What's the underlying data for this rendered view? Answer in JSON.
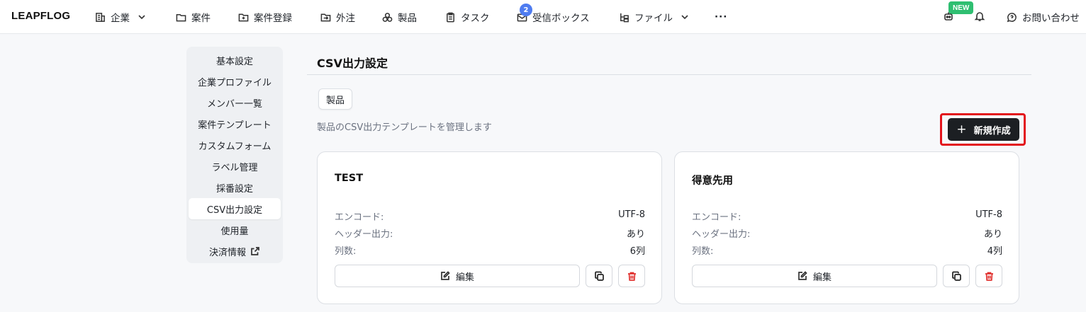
{
  "topbar": {
    "brand": "LEAPFLOG",
    "nav": [
      {
        "label": "企業",
        "icon": "building-icon",
        "has_dropdown": true
      },
      {
        "label": "案件",
        "icon": "folder-icon"
      },
      {
        "label": "案件登録",
        "icon": "folder-plus-icon"
      },
      {
        "label": "外注",
        "icon": "outsource-icon"
      },
      {
        "label": "製品",
        "icon": "products-icon"
      },
      {
        "label": "タスク",
        "icon": "clipboard-icon"
      },
      {
        "label": "受信ボックス",
        "icon": "inbox-icon",
        "badge": "2"
      },
      {
        "label": "ファイル",
        "icon": "files-icon",
        "has_dropdown": true
      }
    ],
    "more": "···",
    "new_badge": "NEW",
    "contact": "お問い合わせ"
  },
  "sidebar": {
    "items": [
      {
        "label": "基本設定"
      },
      {
        "label": "企業プロファイル"
      },
      {
        "label": "メンバー一覧"
      },
      {
        "label": "案件テンプレート"
      },
      {
        "label": "カスタムフォーム"
      },
      {
        "label": "ラベル管理"
      },
      {
        "label": "採番設定"
      },
      {
        "label": "CSV出力設定",
        "active": true
      },
      {
        "label": "使用量"
      },
      {
        "label": "決済情報",
        "external": true
      }
    ]
  },
  "main": {
    "title": "CSV出力設定",
    "tab": "製品",
    "description": "製品のCSV出力テンプレートを管理します",
    "new_button": "新規作成",
    "new_button_icon": "+",
    "cards": [
      {
        "name": "TEST",
        "rows": [
          {
            "key": "エンコード:",
            "value": "UTF-8"
          },
          {
            "key": "ヘッダー出力:",
            "value": "あり"
          },
          {
            "key": "列数:",
            "value": "6列"
          }
        ],
        "edit_label": "編集"
      },
      {
        "name": "得意先用",
        "rows": [
          {
            "key": "エンコード:",
            "value": "UTF-8"
          },
          {
            "key": "ヘッダー出力:",
            "value": "あり"
          },
          {
            "key": "列数:",
            "value": "4列"
          }
        ],
        "edit_label": "編集"
      }
    ]
  },
  "colors": {
    "accent_badge": "#4f7cf0",
    "new_badge": "#2fbf71",
    "highlight": "#e3141c",
    "delete": "#e0312f",
    "primary_button": "#1c1f23"
  }
}
